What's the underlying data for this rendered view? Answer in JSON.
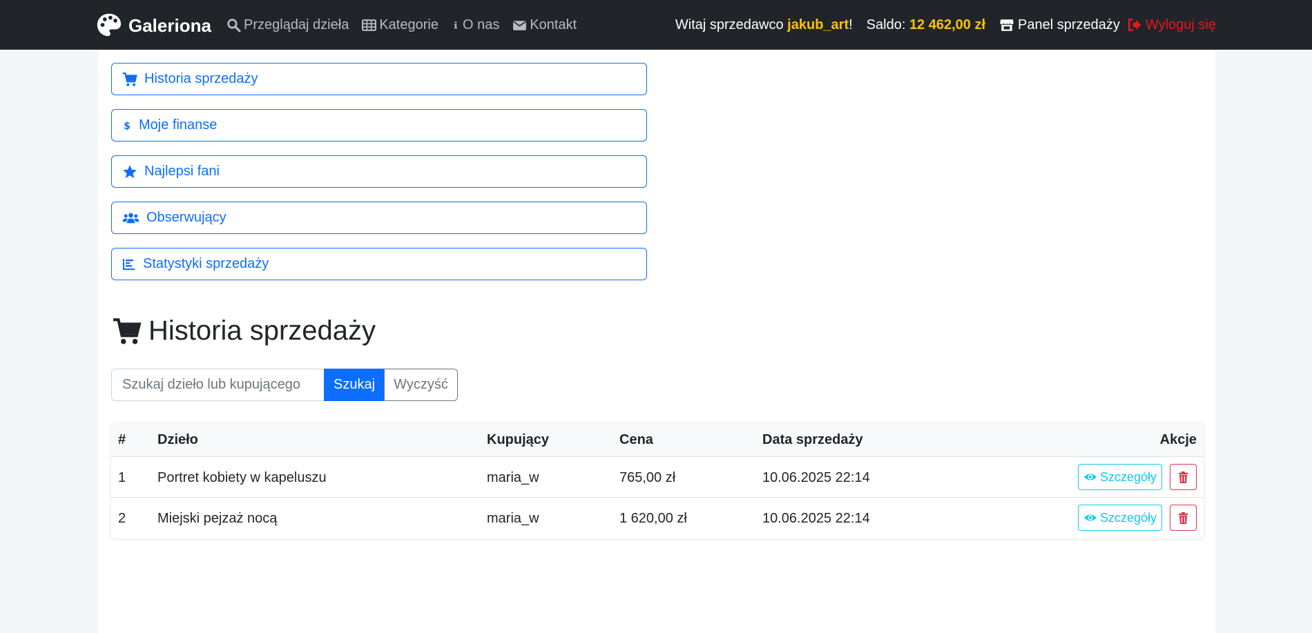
{
  "navbar": {
    "brand": "Galeriona",
    "links": [
      {
        "label": "Przeglądaj dzieła",
        "icon": "search-icon"
      },
      {
        "label": "Kategorie",
        "icon": "table-icon"
      },
      {
        "label": "O nas",
        "icon": "info-icon"
      },
      {
        "label": "Kontakt",
        "icon": "envelope-icon"
      }
    ],
    "greeting_prefix": "Witaj sprzedawco ",
    "username": "jakub_art",
    "greeting_suffix": "!",
    "balance_label": "Saldo: ",
    "balance_value": "12 462,00 zł",
    "panel_label": "Panel sprzedaży",
    "logout_label": "Wyloguj się"
  },
  "menu": [
    {
      "label": "Historia sprzedaży",
      "icon": "cart-icon"
    },
    {
      "label": "Moje finanse",
      "icon": "dollar-icon"
    },
    {
      "label": "Najlepsi fani",
      "icon": "star-icon"
    },
    {
      "label": "Obserwujący",
      "icon": "users-icon"
    },
    {
      "label": "Statystyki sprzedaży",
      "icon": "bar-chart-icon"
    }
  ],
  "page": {
    "title": "Historia sprzedaży"
  },
  "search": {
    "placeholder": "Szukaj dzieło lub kupującego",
    "value": "",
    "submit_label": "Szukaj",
    "clear_label": "Wyczyść"
  },
  "table": {
    "headers": [
      "#",
      "Dzieło",
      "Kupujący",
      "Cena",
      "Data sprzedaży",
      "Akcje"
    ],
    "rows": [
      {
        "num": "1",
        "artwork": "Portret kobiety w kapeluszu",
        "buyer": "maria_w",
        "price": "765,00 zł",
        "date": "10.06.2025 22:14",
        "details_label": "Szczegóły"
      },
      {
        "num": "2",
        "artwork": "Miejski pejzaż nocą",
        "buyer": "maria_w",
        "price": "1 620,00 zł",
        "date": "10.06.2025 22:14",
        "details_label": "Szczegóły"
      }
    ]
  },
  "colors": {
    "navbar_bg": "#212529",
    "accent": "#0d6efd",
    "highlight": "#ffc107",
    "danger": "#dc3545",
    "info": "#0dcaf0"
  }
}
